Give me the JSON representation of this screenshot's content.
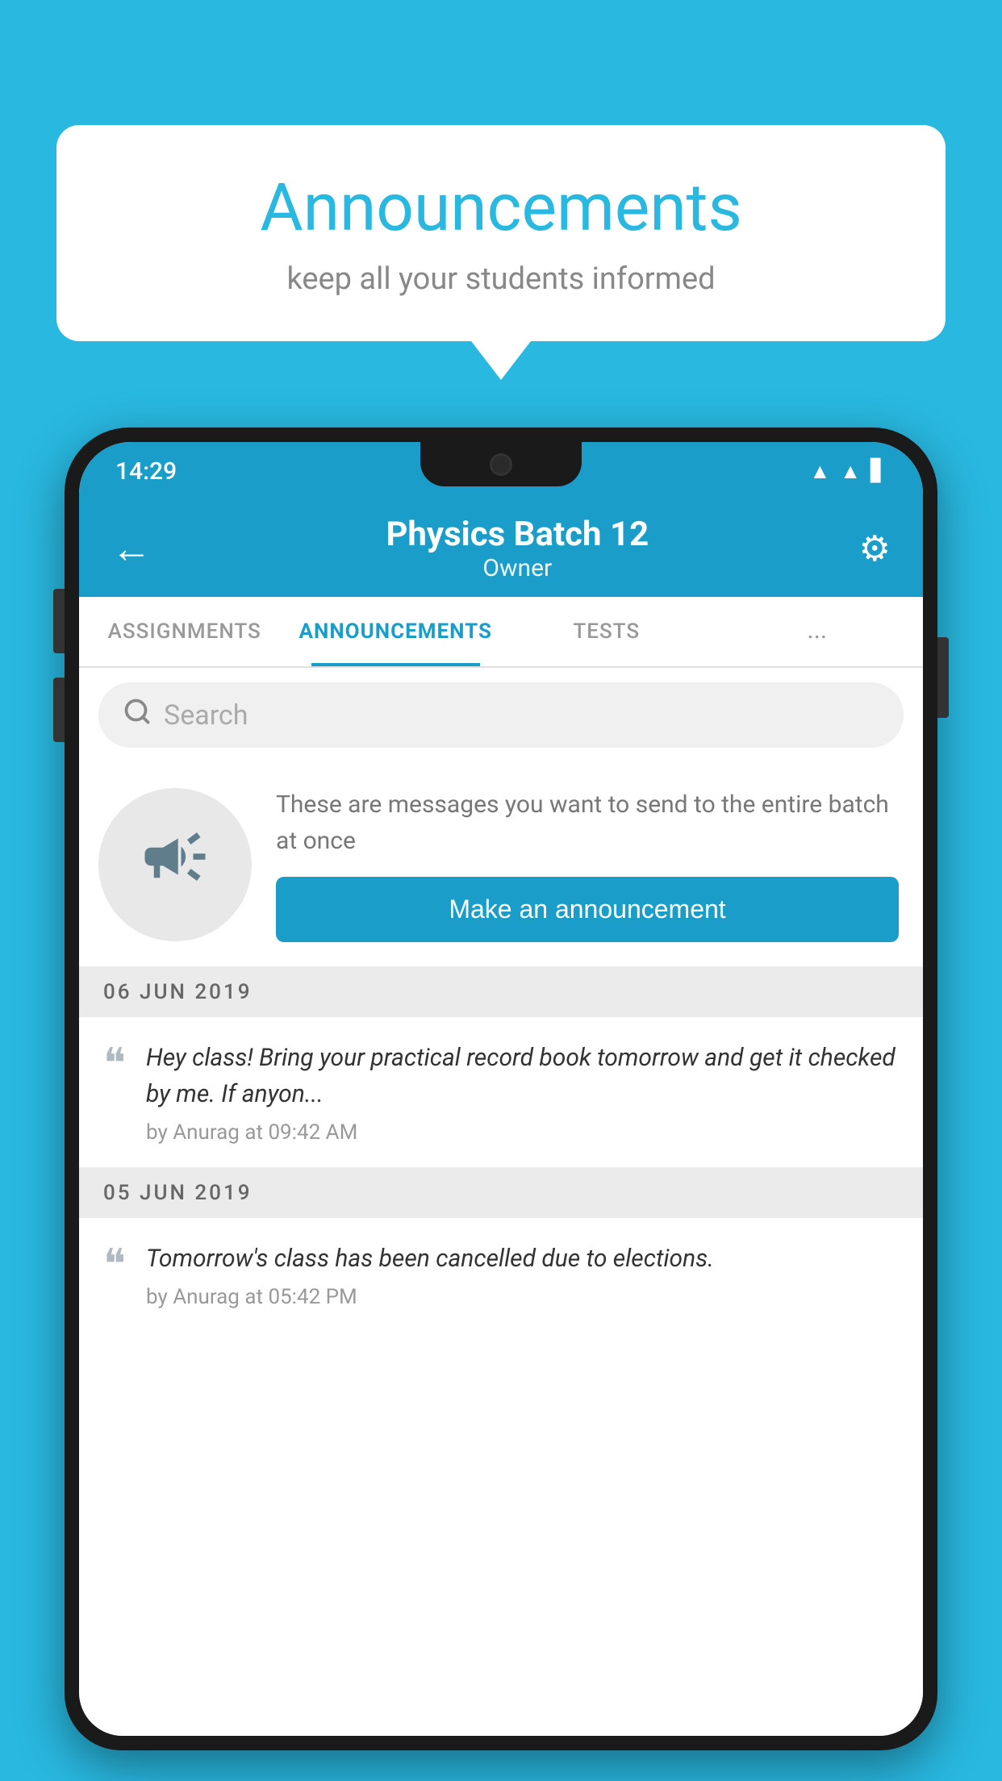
{
  "background_color": "#29b8e0",
  "speech_bubble": {
    "title": "Announcements",
    "subtitle": "keep all your students informed"
  },
  "status_bar": {
    "time": "14:29",
    "icons": [
      "wifi",
      "signal",
      "battery"
    ]
  },
  "app_bar": {
    "back_label": "←",
    "title": "Physics Batch 12",
    "subtitle": "Owner",
    "settings_label": "⚙"
  },
  "tabs": [
    {
      "label": "ASSIGNMENTS",
      "active": false
    },
    {
      "label": "ANNOUNCEMENTS",
      "active": true
    },
    {
      "label": "TESTS",
      "active": false
    },
    {
      "label": "...",
      "active": false
    }
  ],
  "search": {
    "placeholder": "Search"
  },
  "promo": {
    "text": "These are messages you want to send to the entire batch at once",
    "button_label": "Make an announcement"
  },
  "announcements": [
    {
      "date": "06  JUN  2019",
      "text": "Hey class! Bring your practical record book tomorrow and get it checked by me. If anyon...",
      "meta": "by Anurag at 09:42 AM"
    },
    {
      "date": "05  JUN  2019",
      "text": "Tomorrow's class has been cancelled due to elections.",
      "meta": "by Anurag at 05:42 PM"
    }
  ]
}
